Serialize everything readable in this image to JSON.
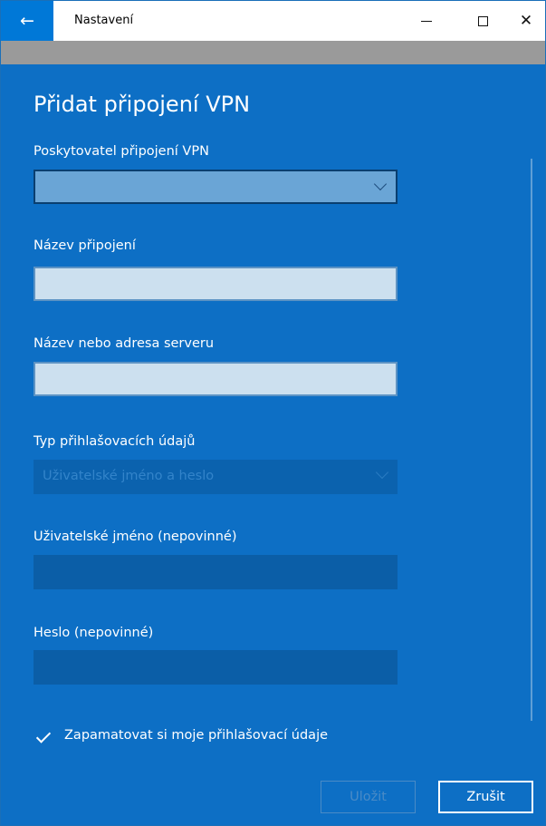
{
  "window": {
    "title": "Nastavení",
    "back_icon": "←",
    "close_icon": "✕"
  },
  "page": {
    "heading": "Přidat připojení VPN"
  },
  "form": {
    "provider": {
      "label": "Poskytovatel připojení VPN",
      "value": ""
    },
    "connection_name": {
      "label": "Název připojení",
      "value": ""
    },
    "server": {
      "label": "Název nebo adresa serveru",
      "value": ""
    },
    "signin_type": {
      "label": "Typ přihlašovacích údajů",
      "value": "Uživatelské jméno a heslo"
    },
    "username": {
      "label": "Uživatelské jméno (nepovinné)",
      "value": ""
    },
    "password": {
      "label": "Heslo (nepovinné)",
      "value": ""
    },
    "remember": {
      "label": "Zapamatovat si moje přihlašovací údaje",
      "checked": true
    }
  },
  "buttons": {
    "save": "Uložit",
    "cancel": "Zrušit"
  },
  "colors": {
    "accent": "#0078d7",
    "panel_background": "#0d6fc5"
  }
}
